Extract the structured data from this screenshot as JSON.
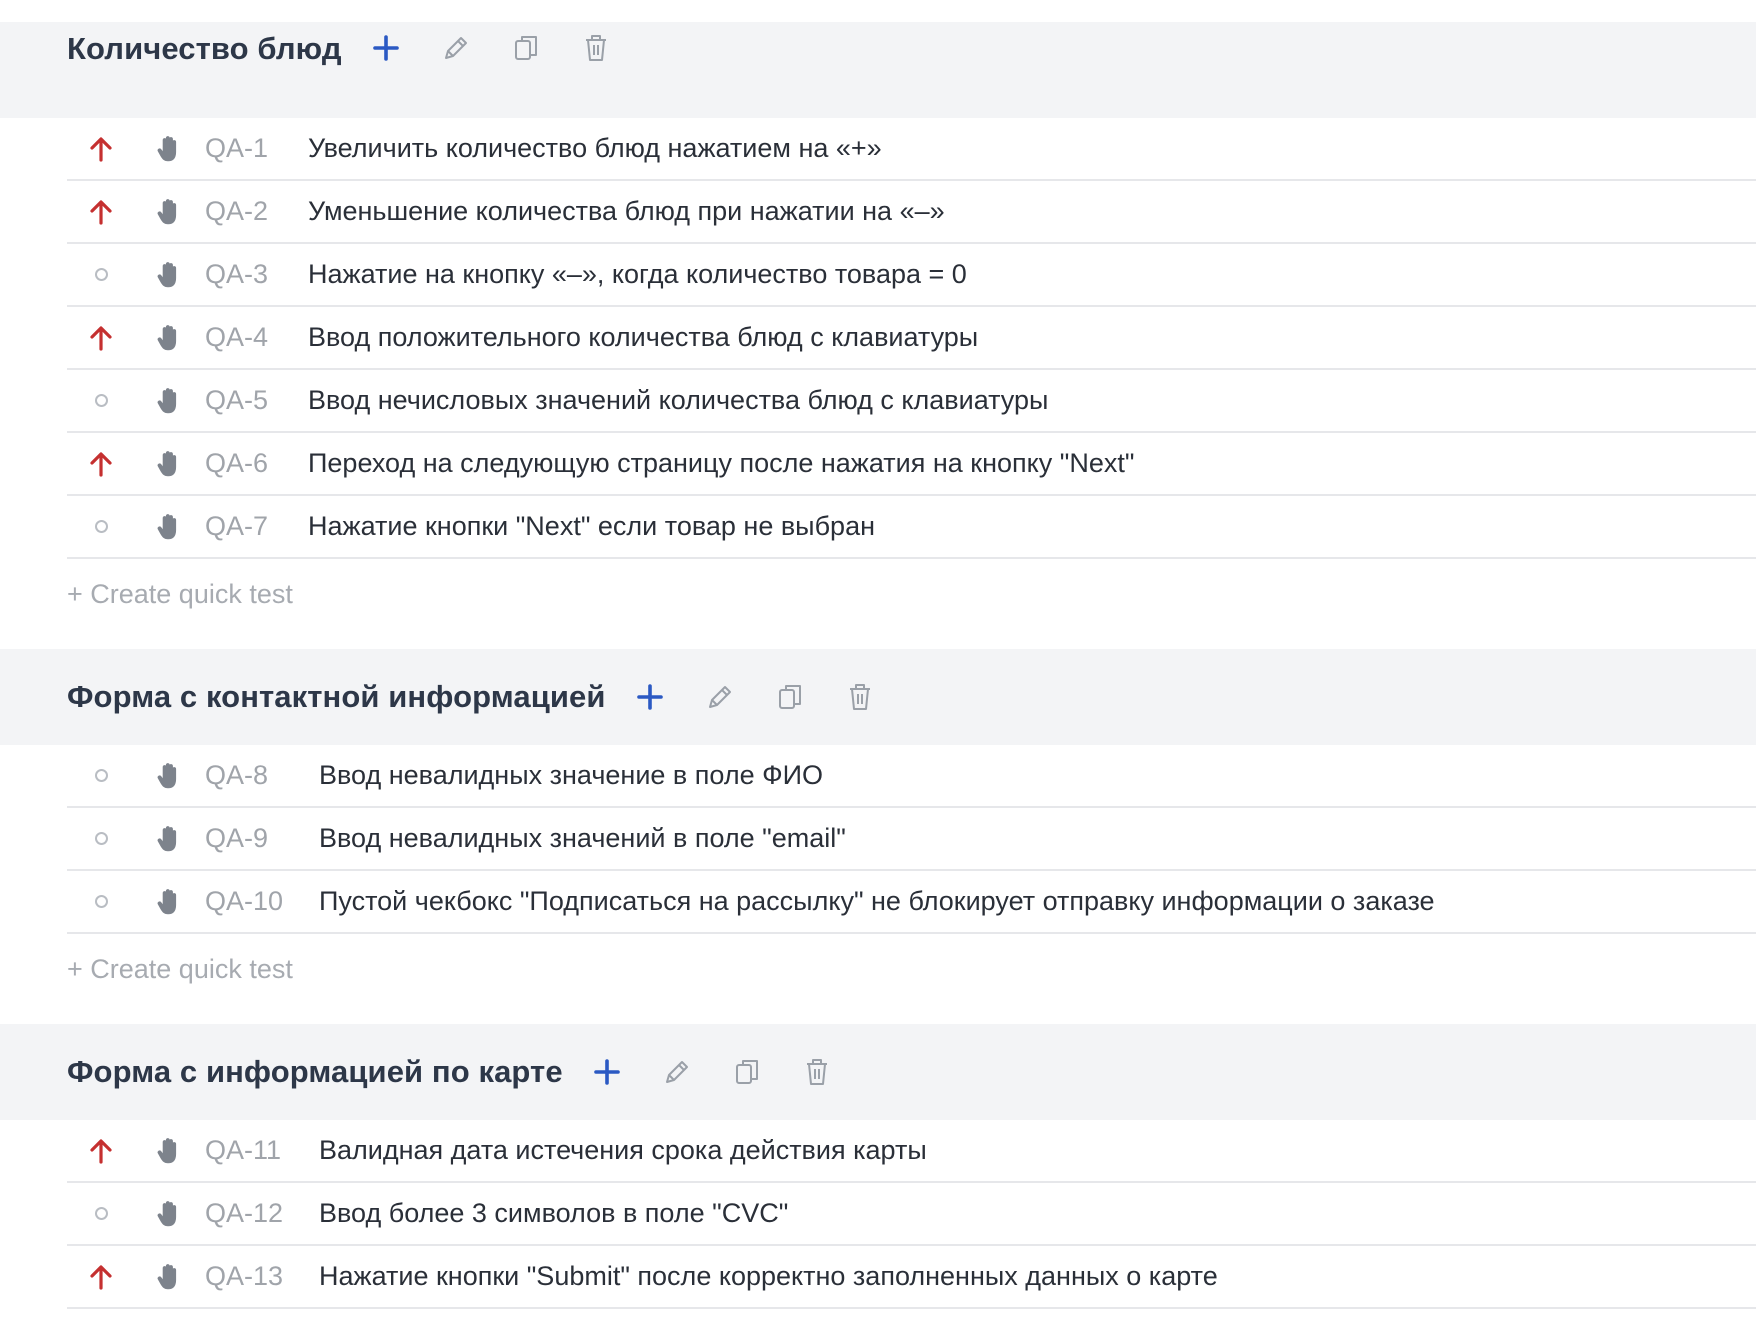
{
  "colors": {
    "high_priority": "#c53030",
    "add_blue": "#2b59c3",
    "icon_gray": "#9aa0a8"
  },
  "icons": {
    "add": "plus-icon",
    "edit": "pencil-icon",
    "clone": "copy-icon",
    "delete": "trash-icon",
    "manual": "hand-icon",
    "priority_high": "arrow-up-icon",
    "priority_normal": "circle-icon"
  },
  "quick_create_label": "+ Create quick test",
  "suites": [
    {
      "title": "Количество блюд",
      "tests": [
        {
          "id": "QA-1",
          "title": "Увеличить количество блюд нажатием на «+»",
          "priority": "high"
        },
        {
          "id": "QA-2",
          "title": "Уменьшение количества блюд при нажатии на «–»",
          "priority": "high"
        },
        {
          "id": "QA-3",
          "title": "Нажатие на кнопку «–», когда количество товара = 0",
          "priority": "normal"
        },
        {
          "id": "QA-4",
          "title": "Ввод положительного количества блюд с клавиатуры",
          "priority": "high"
        },
        {
          "id": "QA-5",
          "title": "Ввод нечисловых значений количества блюд с клавиатуры",
          "priority": "normal"
        },
        {
          "id": "QA-6",
          "title": "Переход на следующую страницу после нажатия на кнопку \"Next\"",
          "priority": "high"
        },
        {
          "id": "QA-7",
          "title": "Нажатие кнопки \"Next\" если товар не выбран",
          "priority": "normal"
        }
      ]
    },
    {
      "title": "Форма с контактной информацией",
      "tests": [
        {
          "id": "QA-8",
          "title": "Ввод невалидных значение в поле ФИО",
          "priority": "normal"
        },
        {
          "id": "QA-9",
          "title": "Ввод невалидных значений в поле \"email\"",
          "priority": "normal"
        },
        {
          "id": "QA-10",
          "title": "Пустой чекбокс \"Подписаться на рассылку\" не блокирует отправку информации о заказе",
          "priority": "normal"
        }
      ]
    },
    {
      "title": "Форма с информацией по карте",
      "tests": [
        {
          "id": "QA-11",
          "title": "Валидная дата истечения срока действия карты",
          "priority": "high"
        },
        {
          "id": "QA-12",
          "title": "Ввод более 3 символов в поле \"CVC\"",
          "priority": "normal"
        },
        {
          "id": "QA-13",
          "title": "Нажатие кнопки \"Submit\" после корректно заполненных данных о карте",
          "priority": "high"
        }
      ]
    }
  ]
}
